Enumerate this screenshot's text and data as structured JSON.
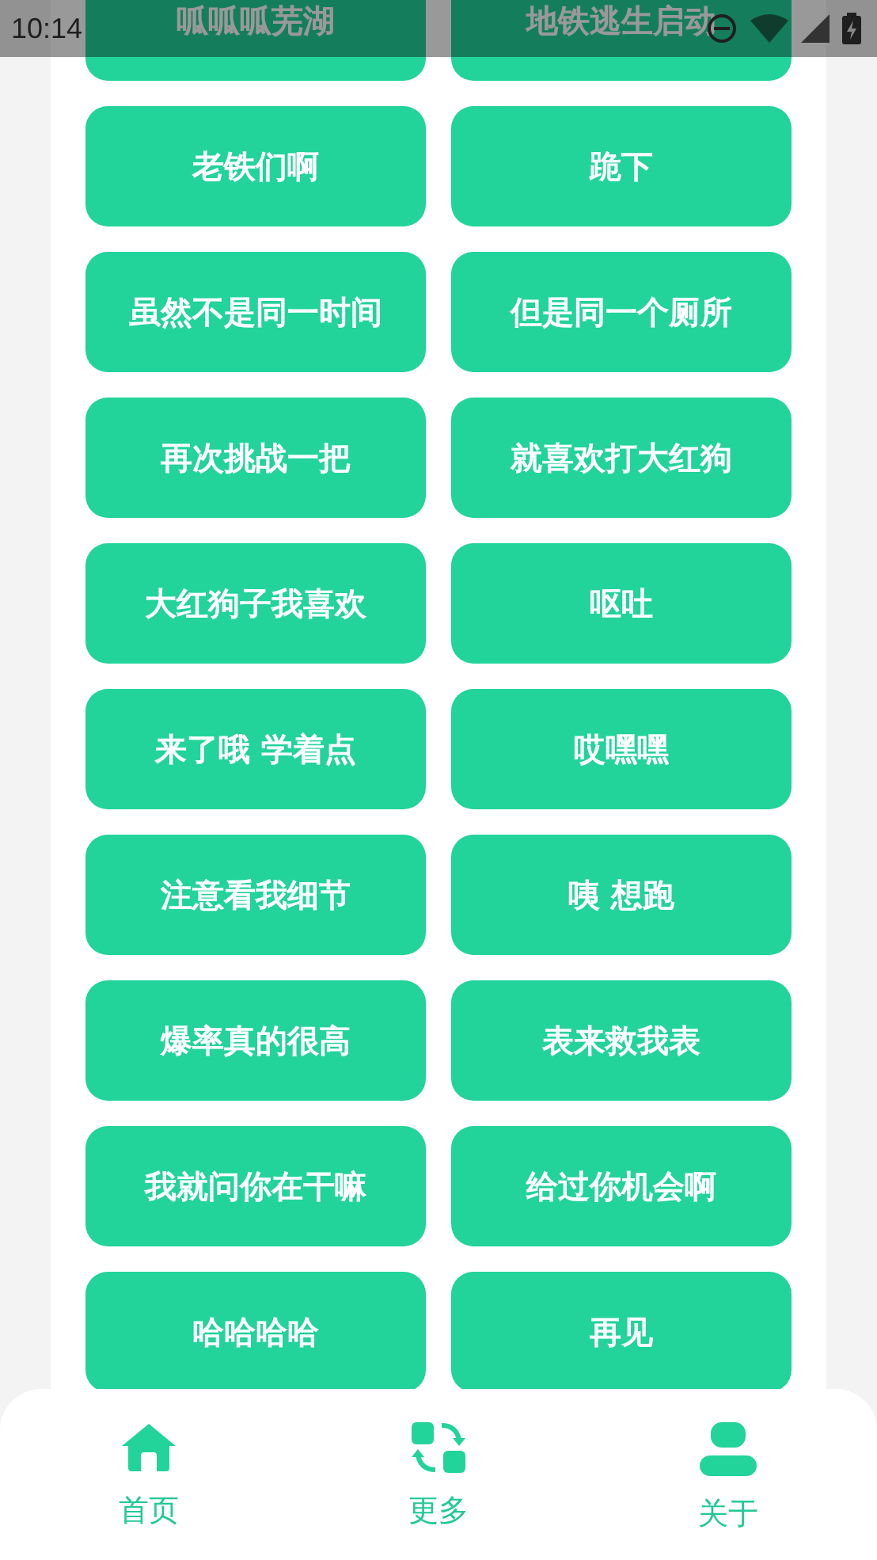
{
  "status_bar": {
    "time": "10:14"
  },
  "buttons": [
    "呱呱呱芜湖",
    "地铁逃生启动",
    "老铁们啊",
    "跪下",
    "虽然不是同一时间",
    "但是同一个厕所",
    "再次挑战一把",
    "就喜欢打大红狗",
    "大红狗子我喜欢",
    "呕吐",
    "来了哦 学着点",
    "哎嘿嘿",
    "注意看我细节",
    "咦 想跑",
    "爆率真的很高",
    "表来救我表",
    "我就问你在干嘛",
    "给过你机会啊",
    "哈哈哈哈",
    "再见"
  ],
  "nav": [
    {
      "label": "首页"
    },
    {
      "label": "更多"
    },
    {
      "label": "关于"
    }
  ]
}
